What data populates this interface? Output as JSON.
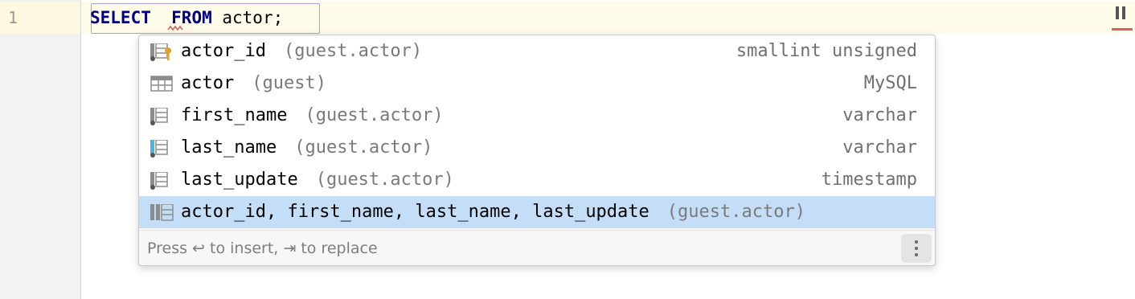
{
  "editor": {
    "line_number": "1",
    "code": {
      "keyword_select": "SELECT",
      "gap": "  ",
      "keyword_from": "FROM",
      "table": " actor;"
    }
  },
  "completion": {
    "items": [
      {
        "name": "actor_id",
        "context": "(guest.actor)",
        "type": "smallint unsigned",
        "icon": "primary-key-column-icon"
      },
      {
        "name": "actor",
        "context": "(guest)",
        "type": "MySQL",
        "icon": "table-icon"
      },
      {
        "name": "first_name",
        "context": "(guest.actor)",
        "type": "varchar",
        "icon": "column-icon"
      },
      {
        "name": "last_name",
        "context": "(guest.actor)",
        "type": "varchar",
        "icon": "indexed-column-icon"
      },
      {
        "name": "last_update",
        "context": "(guest.actor)",
        "type": "timestamp",
        "icon": "column-icon"
      },
      {
        "name": "actor_id, first_name, last_name, last_update",
        "context": "(guest.actor)",
        "type": "",
        "icon": "all-columns-icon"
      }
    ],
    "selected_index": 5,
    "hint": "Press ↩ to insert, ⇥ to replace"
  },
  "colors": {
    "selection": "#c5def8",
    "keyword": "#000080",
    "error": "#d9625a",
    "key_icon": "#e0a22a",
    "index_icon": "#4bb6e3"
  }
}
